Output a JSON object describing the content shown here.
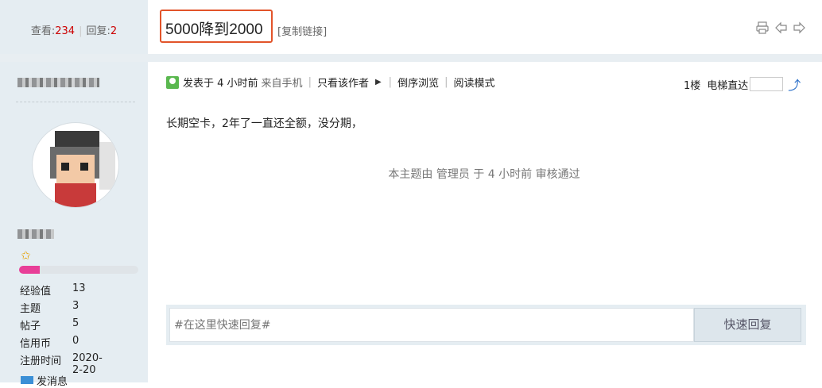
{
  "header": {
    "views_label": "查看:",
    "views_count": "234",
    "replies_label": "回复:",
    "replies_count": "2",
    "title": "5000降到2000",
    "copy_link": "[复制链接]",
    "icons": [
      "printer-icon",
      "prev-thread-icon",
      "next-thread-icon"
    ]
  },
  "user": {
    "stats": [
      {
        "label": "经验值",
        "value": "13"
      },
      {
        "label": "主题",
        "value": "3"
      },
      {
        "label": "帖子",
        "value": "5"
      },
      {
        "label": "信用币",
        "value": "0"
      },
      {
        "label": "注册时间",
        "value": "2020-2-20"
      }
    ],
    "level_progress": 0.17,
    "send_message": "发消息"
  },
  "post": {
    "posted_at": "发表于 4 小时前",
    "from_mobile": "来自手机",
    "only_author": "只看该作者",
    "reverse_order": "倒序浏览",
    "reading_mode": "阅读模式",
    "floor": "1楼",
    "jump_label": "电梯直达",
    "content": "长期空卡，2年了一直还全额，没分期，",
    "audit": "本主题由 管理员 于 4 小时前 审核通过"
  },
  "reply": {
    "placeholder": "#在这里快速回复#",
    "button": "快速回复"
  },
  "colors": {
    "accent": "#e2542a",
    "count": "#cc0000",
    "sidebar": "#e5edf2",
    "progress": "#e83f98"
  }
}
